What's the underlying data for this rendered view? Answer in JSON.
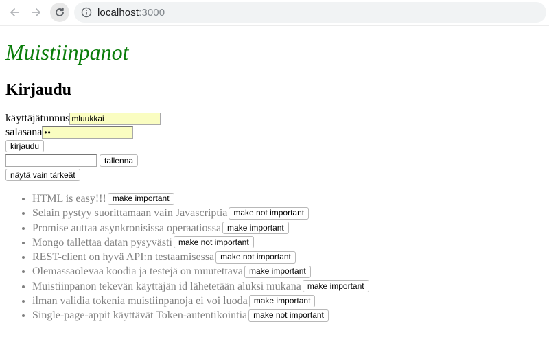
{
  "browser": {
    "url_host": "localhost",
    "url_port": ":3000"
  },
  "page": {
    "title": "Muistiinpanot",
    "login_heading": "Kirjaudu",
    "form": {
      "username_label": "käyttäjätunnus",
      "username_value": "mluukkai",
      "password_label": "salasana",
      "password_value": "••",
      "login_button": "kirjaudu",
      "save_button": "tallenna",
      "show_important_button": "näytä vain tärkeät"
    },
    "notes": [
      {
        "content": "HTML is easy!!!",
        "button": "make important"
      },
      {
        "content": "Selain pystyy suorittamaan vain Javascriptia",
        "button": "make not important"
      },
      {
        "content": "Promise auttaa asynkronisissa operaatiossa",
        "button": "make important"
      },
      {
        "content": "Mongo tallettaa datan pysyvästi",
        "button": "make not important"
      },
      {
        "content": "REST-client on hyvä API:n testaamisessa",
        "button": "make not important"
      },
      {
        "content": "Olemassaolevaa koodia ja testejä on muutettava",
        "button": "make important"
      },
      {
        "content": "Muistiinpanon tekevän käyttäjän id lähetetään aluksi mukana",
        "button": "make important"
      },
      {
        "content": "ilman validia tokenia muistiinpanoja ei voi luoda",
        "button": "make important"
      },
      {
        "content": "Single-page-appit käyttävät Token-autentikointia",
        "button": "make not important"
      }
    ]
  },
  "colors": {
    "title": "#0a7d0a",
    "note_text": "#808080",
    "autofill": "#fafdc1"
  }
}
